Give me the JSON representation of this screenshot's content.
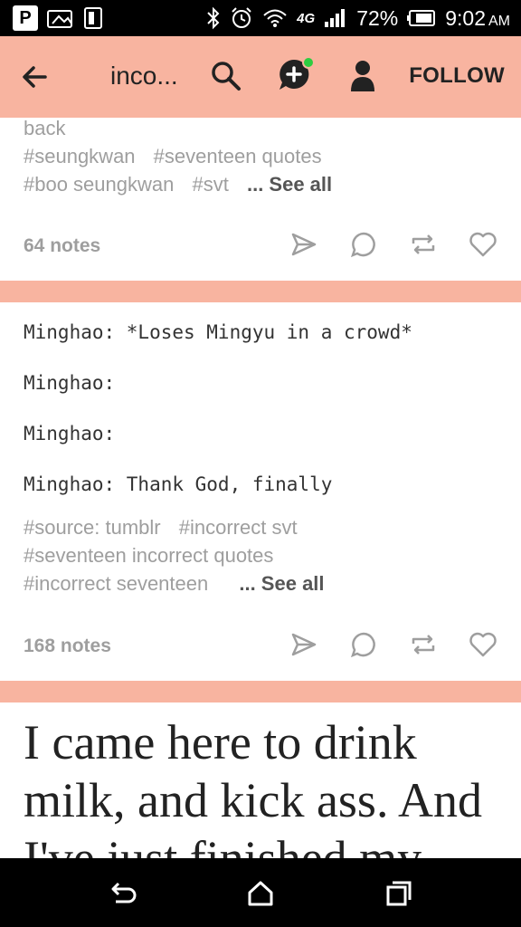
{
  "status_bar": {
    "carrier_icon": "P",
    "battery_percent": "72%",
    "time": "9:02",
    "ampm": "AM",
    "network": "4G"
  },
  "header": {
    "title": "inco...",
    "follow_label": "FOLLOW"
  },
  "post1": {
    "partial_text": "back",
    "tags_row1": [
      "#seungkwan",
      "#seventeen quotes"
    ],
    "tags_row2": [
      "#boo seungkwan",
      "#svt"
    ],
    "see_all": "... See all",
    "notes": "64 notes"
  },
  "post2": {
    "chat": [
      "Minghao: *Loses Mingyu in a crowd*",
      "Minghao:",
      "Minghao:",
      "Minghao: Thank God, finally"
    ],
    "tags_row1": [
      "#source: tumblr",
      "#incorrect svt"
    ],
    "tags_row2": [
      "#seventeen incorrect quotes"
    ],
    "tags_row3": [
      "#incorrect seventeen"
    ],
    "see_all": "... See all",
    "notes": "168 notes"
  },
  "post3": {
    "quote": "I came here to drink milk, and kick ass. And I've just finished my"
  },
  "colors": {
    "accent": "#f8b4a0",
    "online_dot": "#2ecc40",
    "tag_gray": "#9e9e9e"
  }
}
